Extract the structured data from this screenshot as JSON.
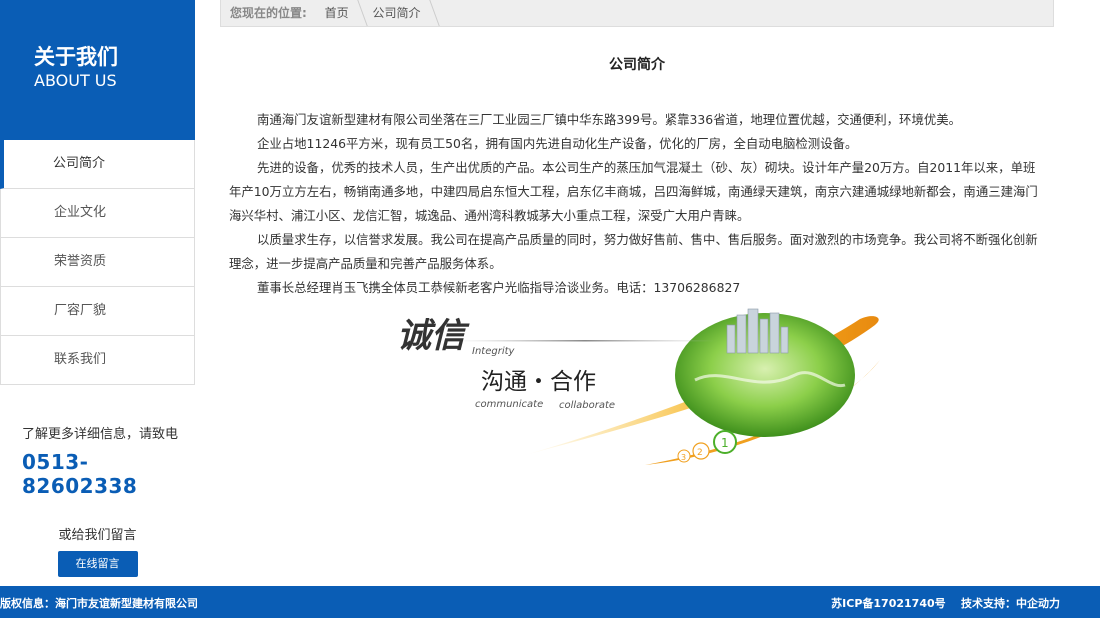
{
  "sidebar": {
    "title_cn": "关于我们",
    "title_en": "ABOUT US",
    "items": [
      {
        "label": "公司简介"
      },
      {
        "label": "企业文化"
      },
      {
        "label": "荣誉资质"
      },
      {
        "label": "厂容厂貌"
      },
      {
        "label": "联系我们"
      }
    ],
    "contact_label": "了解更多详细信息，请致电",
    "phone": "0513-82602338",
    "message_label": "或给我们留言",
    "message_button": "在线留言"
  },
  "breadcrumb": {
    "label": "您现在的位置:",
    "items": [
      "首页",
      "公司简介"
    ]
  },
  "main": {
    "title": "公司简介",
    "paragraphs": [
      "南通海门友谊新型建材有限公司坐落在三厂工业园三厂镇中华东路399号。紧靠336省道，地理位置优越，交通便利，环境优美。",
      "企业占地11246平方米，现有员工50名，拥有国内先进自动化生产设备，优化的厂房，全自动电脑检测设备。",
      "先进的设备，优秀的技术人员，生产出优质的产品。本公司生产的蒸压加气混凝土（砂、灰）砌块。设计年产量20万方。自2011年以来，单班年产10万立方左右，畅销南通多地，中建四局启东恒大工程，启东亿丰商城，吕四海鲜城，南通绿天建筑，南京六建通城绿地新都会，南通三建海门海兴华村、浦江小区、龙信汇智，城逸品、通州湾科教城茅大小重点工程，深受广大用户青睐。",
      "以质量求生存，以信誉求发展。我公司在提高产品质量的同时，努力做好售前、售中、售后服务。面对激烈的市场竞争。我公司将不断强化创新理念，进一步提高产品质量和完善产品服务体系。",
      "董事长总经理肖玉飞携全体员工恭候新老客户光临指导洽谈业务。电话：13706286827"
    ],
    "image": {
      "word1": "诚信",
      "word1_en": "Integrity",
      "word2": "沟通・合作",
      "word2_en_a": "communicate",
      "word2_en_b": "collaborate",
      "n1": "1",
      "n2": "2",
      "n3": "3"
    }
  },
  "footer": {
    "copyright": "版权信息：海门市友谊新型建材有限公司",
    "icp": "苏ICP备17021740号",
    "support": "技术支持：中企动力"
  },
  "colors": {
    "brand": "#0a5db5",
    "accent": "#f0a020",
    "green": "#5cb82e"
  }
}
